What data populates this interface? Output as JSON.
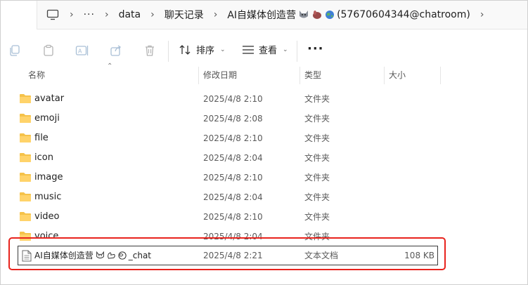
{
  "breadcrumb": {
    "items": [
      "data",
      "聊天记录",
      "AI自媒体创造营",
      "(57670604344@chatroom)"
    ],
    "overflow_label": "···"
  },
  "toolbar": {
    "sort_label": "排序",
    "view_label": "查看",
    "more_label": "···",
    "icons": [
      "copy-icon",
      "paste-icon",
      "rename-icon",
      "share-icon",
      "delete-icon"
    ]
  },
  "columns": {
    "name": "名称",
    "modified": "修改日期",
    "type": "类型",
    "size": "大小"
  },
  "files": [
    {
      "name": "avatar",
      "modified": "2025/4/8 2:10",
      "type": "文件夹",
      "size": ""
    },
    {
      "name": "emoji",
      "modified": "2025/4/8 2:08",
      "type": "文件夹",
      "size": ""
    },
    {
      "name": "file",
      "modified": "2025/4/8 2:10",
      "type": "文件夹",
      "size": ""
    },
    {
      "name": "icon",
      "modified": "2025/4/8 2:04",
      "type": "文件夹",
      "size": ""
    },
    {
      "name": "image",
      "modified": "2025/4/8 2:10",
      "type": "文件夹",
      "size": ""
    },
    {
      "name": "music",
      "modified": "2025/4/8 2:04",
      "type": "文件夹",
      "size": ""
    },
    {
      "name": "video",
      "modified": "2025/4/8 2:10",
      "type": "文件夹",
      "size": ""
    },
    {
      "name": "voice",
      "modified": "2025/4/8 2:04",
      "type": "文件夹",
      "size": ""
    }
  ],
  "selected_file": {
    "name_prefix": "AI自媒体创造营",
    "name_suffix": "_chat",
    "modified": "2025/4/8 2:21",
    "type": "文本文档",
    "size": "108 KB"
  },
  "colors": {
    "folder": "#f5c24a",
    "highlight": "#e8231d",
    "toolbar_disabled": "#b0c4d8"
  }
}
